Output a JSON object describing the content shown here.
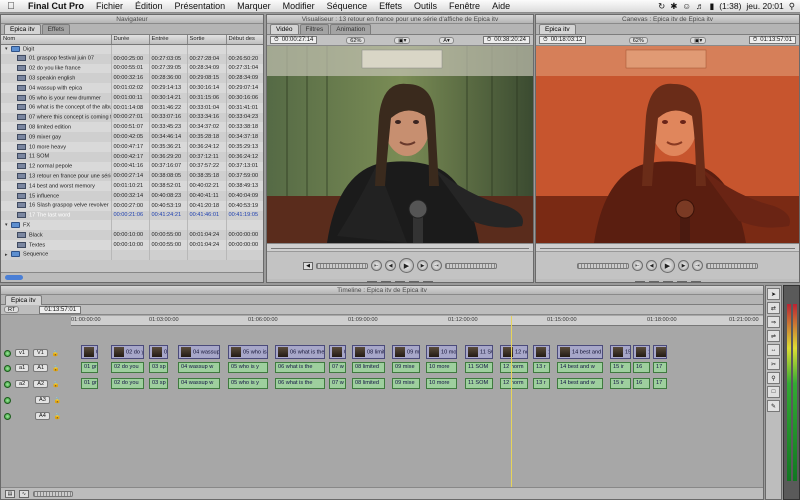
{
  "menubar": {
    "app": "Final Cut Pro",
    "items": [
      "Fichier",
      "Édition",
      "Présentation",
      "Marquer",
      "Modifier",
      "Séquence",
      "Effets",
      "Outils",
      "Fenêtre",
      "Aide"
    ],
    "battery": "(1:38)",
    "clock": "jeu. 20:01"
  },
  "browser": {
    "title": "Navigateur",
    "tabs": [
      "Epica itv",
      "Effets"
    ],
    "columns": [
      "Nom",
      "Durée",
      "Entrée",
      "Sortie",
      "Début des"
    ],
    "rows": [
      {
        "name": "Digit",
        "kind": "folder",
        "d": "",
        "i": "",
        "o": "",
        "s": ""
      },
      {
        "name": "01 graspop festival juin 07",
        "kind": "clip",
        "d": "00:00:25:00",
        "i": "00:27:03:05",
        "o": "00:27:28:04",
        "s": "00:26:50:20"
      },
      {
        "name": "02 do you like france",
        "kind": "clip",
        "d": "00:00:55:01",
        "i": "00:27:39:05",
        "o": "00:28:34:09",
        "s": "00:27:31:04"
      },
      {
        "name": "03 speakin english",
        "kind": "clip",
        "d": "00:00:32:16",
        "i": "00:28:36:00",
        "o": "00:29:08:15",
        "s": "00:28:34:09"
      },
      {
        "name": "04 wassup with epica",
        "kind": "clip",
        "d": "00:01:02:02",
        "i": "00:29:14:13",
        "o": "00:30:16:14",
        "s": "00:29:07:14"
      },
      {
        "name": "05 who is your new drummer",
        "kind": "clip",
        "d": "00:01:00:11",
        "i": "00:30:14:21",
        "o": "00:31:15:06",
        "s": "00:30:16:06"
      },
      {
        "name": "06 what is the concept of the album",
        "kind": "clip",
        "d": "00:01:14:08",
        "i": "00:31:46:22",
        "o": "00:33:01:04",
        "s": "00:31:41:01"
      },
      {
        "name": "07 where this concept is coming from",
        "kind": "clip",
        "d": "00:00:27:01",
        "i": "00:33:07:16",
        "o": "00:33:34:16",
        "s": "00:33:04:23"
      },
      {
        "name": "08 limited edition",
        "kind": "clip",
        "d": "00:00:51:07",
        "i": "00:33:45:23",
        "o": "00:34:37:02",
        "s": "00:33:38:18"
      },
      {
        "name": "09 mixer gay",
        "kind": "clip",
        "d": "00:00:42:05",
        "i": "00:34:46:14",
        "o": "00:35:28:18",
        "s": "00:34:37:18"
      },
      {
        "name": "10 more heavy",
        "kind": "clip",
        "d": "00:00:47:17",
        "i": "00:35:36:21",
        "o": "00:36:24:12",
        "s": "00:35:29:13"
      },
      {
        "name": "11 SOM",
        "kind": "clip",
        "d": "00:00:42:17",
        "i": "00:36:29:20",
        "o": "00:37:12:11",
        "s": "00:36:24:12"
      },
      {
        "name": "12 normal pepole",
        "kind": "clip",
        "d": "00:00:41:16",
        "i": "00:37:16:07",
        "o": "00:37:57:22",
        "s": "00:37:13:01"
      },
      {
        "name": "13 retour en france pour une série d'affiches",
        "kind": "clip",
        "d": "00:00:27:14",
        "i": "00:38:08:05",
        "o": "00:38:35:18",
        "s": "00:37:59:00"
      },
      {
        "name": "14 best and worst memory",
        "kind": "clip",
        "d": "00:01:10:21",
        "i": "00:38:52:01",
        "o": "00:40:02:21",
        "s": "00:38:49:13"
      },
      {
        "name": "15 influence",
        "kind": "clip",
        "d": "00:00:32:14",
        "i": "00:40:08:23",
        "o": "00:40:41:11",
        "s": "00:40:04:09"
      },
      {
        "name": "16  Slash graspop velve revolver",
        "kind": "clip",
        "d": "00:00:27:00",
        "i": "00:40:53:19",
        "o": "00:41:20:18",
        "s": "00:40:53:19"
      },
      {
        "name": "17 The last word",
        "kind": "clip",
        "d": "00:00:21:06",
        "i": "00:41:24:21",
        "o": "00:41:46:01",
        "s": "00:41:19:05",
        "selected": true
      },
      {
        "name": "FX",
        "kind": "folder",
        "d": "",
        "i": "",
        "o": "",
        "s": ""
      },
      {
        "name": "Black",
        "kind": "clip",
        "d": "00:00:10:00",
        "i": "00:00:55:00",
        "o": "00:01:04:24",
        "s": "00:00:00:00"
      },
      {
        "name": "Textes",
        "kind": "clip",
        "d": "00:00:10:00",
        "i": "00:00:55:00",
        "o": "00:01:04:24",
        "s": "00:00:00:00"
      },
      {
        "name": "Sequence",
        "kind": "folder",
        "d": "",
        "i": "",
        "o": "",
        "s": ""
      }
    ]
  },
  "viewer": {
    "title": "Visualiseur : 13 retour en france pour une série d'affiche de Epica itv",
    "tabs": [
      "Vidéo",
      "Filtres",
      "Animation"
    ],
    "tc_left": "00:00:27:14",
    "zoom": "62%",
    "tc_right": "00:38:20:24"
  },
  "canvas": {
    "title": "Canevas : Epica itv de Epica itv",
    "tab": "Epica itv",
    "tc_left": "00:18:03:12",
    "zoom": "62%",
    "tc_right": "01:13:57:01"
  },
  "timeline": {
    "title": "Timeline : Epica itv de Epica itv",
    "tab": "Epica itv",
    "rt": "RT",
    "current_tc": "01:13:57:01",
    "ruler": [
      {
        "label": "01:00:00:00",
        "pos": 0
      },
      {
        "label": "01:03:00:00",
        "pos": 0.112
      },
      {
        "label": "01:06:00:00",
        "pos": 0.255
      },
      {
        "label": "01:09:00:00",
        "pos": 0.399
      },
      {
        "label": "01:12:00:00",
        "pos": 0.543
      },
      {
        "label": "01:15:00:00",
        "pos": 0.686
      },
      {
        "label": "01:18:00:00",
        "pos": 0.83
      },
      {
        "label": "01:21:00:00",
        "pos": 0.974
      }
    ],
    "tracks": [
      {
        "label": "V1",
        "src": "v1",
        "kind": "video"
      },
      {
        "label": "A1",
        "src": "a1",
        "kind": "audio"
      },
      {
        "label": "A2",
        "src": "a2",
        "kind": "audio"
      },
      {
        "label": "A3",
        "src": "",
        "kind": "audio"
      },
      {
        "label": "A4",
        "src": "",
        "kind": "audio"
      }
    ],
    "clips": [
      {
        "label": "01 gr",
        "start": 0.015,
        "width": 0.024
      },
      {
        "label": "02 do you",
        "start": 0.057,
        "width": 0.048
      },
      {
        "label": "03 sp",
        "start": 0.112,
        "width": 0.027
      },
      {
        "label": "04 wassup w",
        "start": 0.154,
        "width": 0.06
      },
      {
        "label": "05 who is y",
        "start": 0.226,
        "width": 0.058
      },
      {
        "label": "06 what is the",
        "start": 0.294,
        "width": 0.072
      },
      {
        "label": "07 w",
        "start": 0.372,
        "width": 0.025
      },
      {
        "label": "08 limited",
        "start": 0.405,
        "width": 0.047
      },
      {
        "label": "09 mixe",
        "start": 0.462,
        "width": 0.04
      },
      {
        "label": "10 more",
        "start": 0.512,
        "width": 0.045
      },
      {
        "label": "11 SOM",
        "start": 0.568,
        "width": 0.04
      },
      {
        "label": "12 norm",
        "start": 0.618,
        "width": 0.04
      },
      {
        "label": "13 r",
        "start": 0.665,
        "width": 0.025
      },
      {
        "label": "14 best and w",
        "start": 0.7,
        "width": 0.067
      },
      {
        "label": "15 ir",
        "start": 0.776,
        "width": 0.03
      },
      {
        "label": "16",
        "start": 0.81,
        "width": 0.025
      },
      {
        "label": "17",
        "start": 0.838,
        "width": 0.02
      }
    ]
  },
  "colors": {
    "accent": "#4a7fd6",
    "video_clip": "#a7a7c9",
    "audio_clip": "#9ecf9e",
    "playhead": "#e7d45a",
    "selected_row": "#8e8e8e"
  }
}
